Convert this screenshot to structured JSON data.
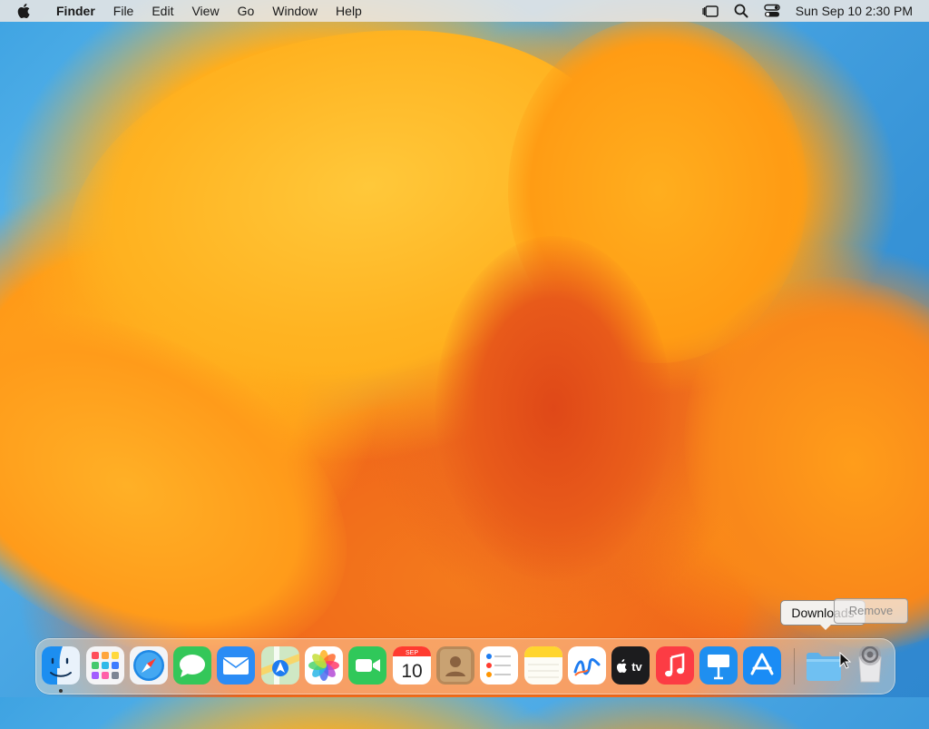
{
  "menubar": {
    "app_name": "Finder",
    "items": [
      "File",
      "Edit",
      "View",
      "Go",
      "Window",
      "Help"
    ],
    "clock": "Sun Sep 10  2:30 PM",
    "status_icons": [
      "stage-manager-icon",
      "spotlight-search-icon",
      "control-center-icon"
    ]
  },
  "dock": {
    "apps": [
      {
        "name": "Finder",
        "icon": "finder-icon",
        "running": true
      },
      {
        "name": "Launchpad",
        "icon": "launchpad-icon"
      },
      {
        "name": "Safari",
        "icon": "safari-icon"
      },
      {
        "name": "Messages",
        "icon": "messages-icon"
      },
      {
        "name": "Mail",
        "icon": "mail-icon"
      },
      {
        "name": "Maps",
        "icon": "maps-icon"
      },
      {
        "name": "Photos",
        "icon": "photos-icon"
      },
      {
        "name": "FaceTime",
        "icon": "facetime-icon"
      },
      {
        "name": "Calendar",
        "icon": "calendar-icon",
        "month": "SEP",
        "day": "10"
      },
      {
        "name": "Contacts",
        "icon": "contacts-icon"
      },
      {
        "name": "Reminders",
        "icon": "reminders-icon"
      },
      {
        "name": "Notes",
        "icon": "notes-icon"
      },
      {
        "name": "Freeform",
        "icon": "freeform-icon"
      },
      {
        "name": "TV",
        "icon": "appletv-icon",
        "label": "tv"
      },
      {
        "name": "Music",
        "icon": "music-icon"
      },
      {
        "name": "Keynote",
        "icon": "keynote-icon"
      },
      {
        "name": "App Store",
        "icon": "appstore-icon"
      },
      {
        "name": "Downloads",
        "icon": "downloads-folder-icon"
      },
      {
        "name": "Trash",
        "icon": "trash-icon"
      }
    ]
  },
  "tooltip": {
    "label": "Downloads"
  },
  "context_action": {
    "label": "Remove"
  },
  "colors": {
    "menubar_bg": "#ece8e4",
    "accent_blue": "#1e88e5",
    "wallpaper_sky": "#3ea3e2",
    "wallpaper_orange": "#ff9e12"
  }
}
